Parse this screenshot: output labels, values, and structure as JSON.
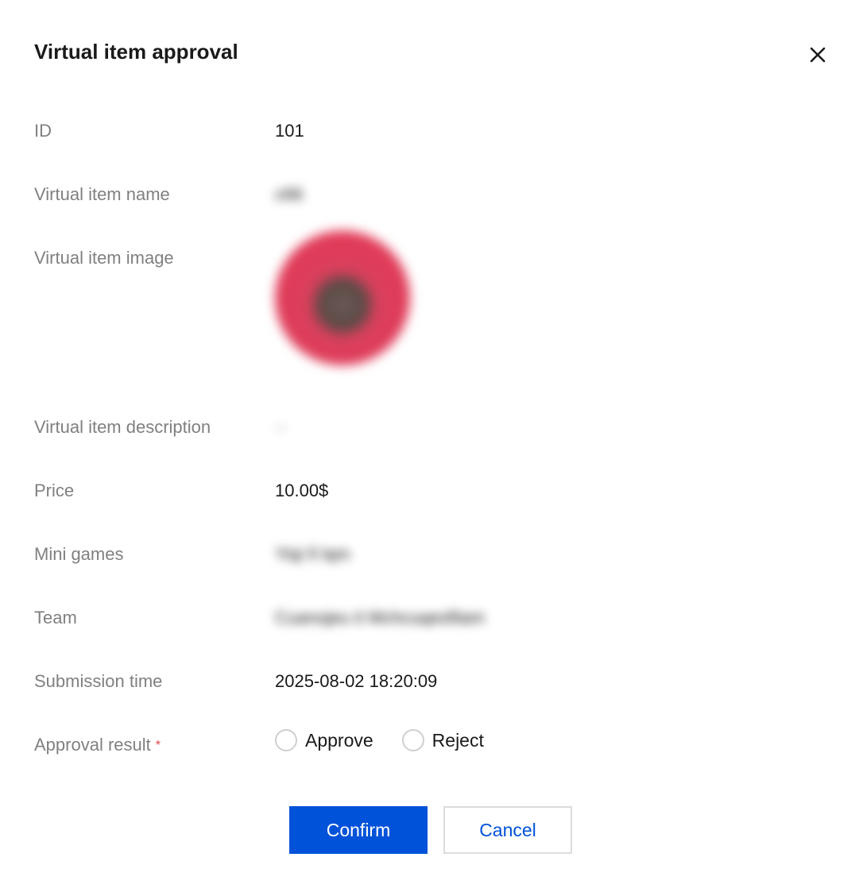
{
  "dialog": {
    "title": "Virtual item approval",
    "close_icon": "close-icon"
  },
  "fields": {
    "id": {
      "label": "ID",
      "value": "101"
    },
    "name": {
      "label": "Virtual item name",
      "value": "c66"
    },
    "image": {
      "label": "Virtual item image"
    },
    "description": {
      "label": "Virtual item description",
      "value": "··"
    },
    "price": {
      "label": "Price",
      "value": "10.00$"
    },
    "mini_games": {
      "label": "Mini games",
      "value": "Yiqi fi lqm"
    },
    "team": {
      "label": "Team",
      "value": "Cuanojeu it Mchcuqesfilam"
    },
    "submission_time": {
      "label": "Submission time",
      "value": "2025-08-02 18:20:09"
    },
    "approval_result": {
      "label": "Approval result",
      "required_mark": "*",
      "options": [
        "Approve",
        "Reject"
      ]
    }
  },
  "buttons": {
    "confirm": "Confirm",
    "cancel": "Cancel"
  },
  "colors": {
    "primary": "#0052d9",
    "required": "#e54545",
    "label": "#808080",
    "text": "#1a1a1a"
  }
}
